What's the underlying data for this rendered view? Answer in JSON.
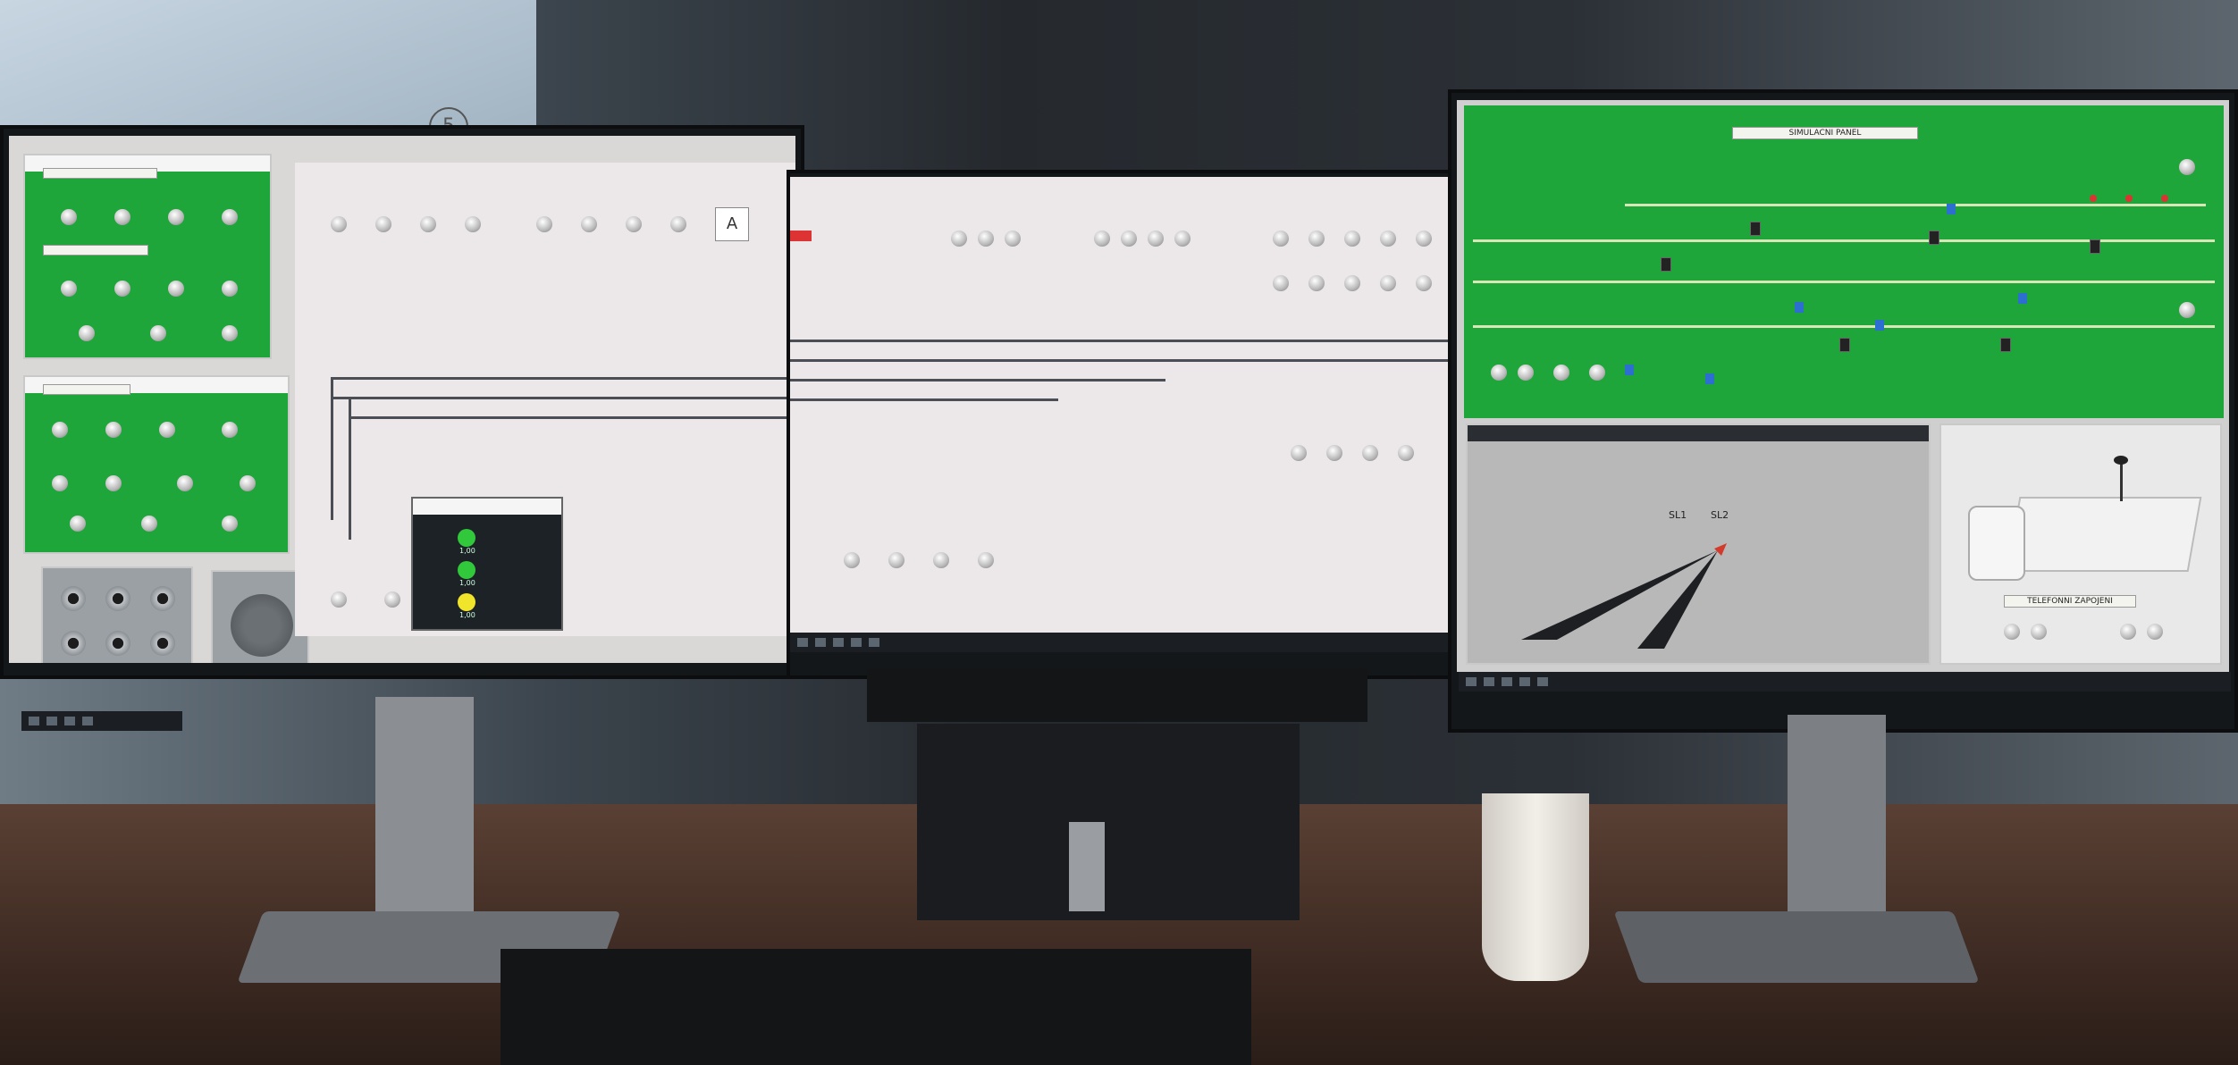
{
  "photo": {
    "subject": "",
    "whiteboard_text": "",
    "circled_number": "5"
  },
  "left_monitor": {
    "panels": [
      "green-panel-upper",
      "green-panel-lower",
      "socket-panel",
      "handset-panel"
    ]
  },
  "center_monitor": {
    "letter_indicator": "A",
    "popup": {
      "title": "",
      "rows": [
        {
          "value": "1,00",
          "lamp": "#32c83c"
        },
        {
          "value": "1,00",
          "lamp": "#32c83c"
        },
        {
          "value": "1,00",
          "lamp": "#f0e52a"
        }
      ]
    }
  },
  "right_monitor": {
    "top_title": "SIMULACNI PANEL",
    "radar": {
      "labels": [
        "SL1",
        "SL2"
      ]
    },
    "phone_label": "TELEFONNI ZAPOJENI"
  },
  "colors": {
    "panel_green": "#1fa63a",
    "screen_bg": "#e8e2e4",
    "desk": "#4a352c"
  }
}
